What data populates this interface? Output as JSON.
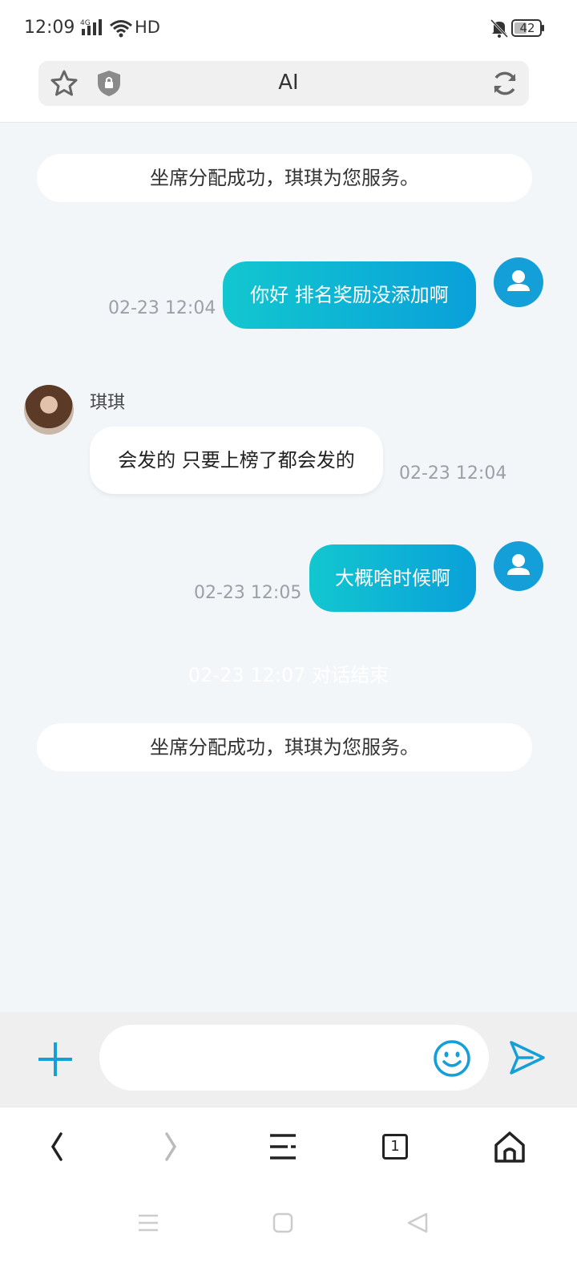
{
  "status_bar": {
    "time": "12:09",
    "network": "HD",
    "signal_label": "4G",
    "battery": "42"
  },
  "url_bar": {
    "title": "AI"
  },
  "messages": {
    "system_1": "坐席分配成功，琪琪为您服务。",
    "out_1_text": "你好 排名奖励没添加啊",
    "out_1_time": "02-23 12:04",
    "agent_name": "琪琪",
    "in_1_text": "会发的 只要上榜了都会发的",
    "in_1_time": "02-23 12:04",
    "out_2_text": "大概啥时候啊",
    "out_2_time": "02-23 12:05",
    "ended_note": "02-23 12:07 对话结束",
    "system_2": "坐席分配成功，琪琪为您服务。"
  },
  "input": {
    "value": "",
    "placeholder": ""
  },
  "browser_nav": {
    "tab_count": "1"
  },
  "colors": {
    "accent": "#149fd8",
    "bubble_start": "#12c7cf",
    "bubble_end": "#0aa0da",
    "chat_background": "#f3f6f9"
  },
  "icons": {
    "url_bar": [
      "star-icon",
      "shield-lock-icon",
      "refresh-icon"
    ],
    "input_bar": [
      "plus-icon",
      "emoji-icon",
      "send-icon"
    ],
    "browser_nav": [
      "back-icon",
      "forward-icon",
      "menu-icon",
      "tabs-icon",
      "home-icon"
    ],
    "system_nav": [
      "recents-icon",
      "home-square-icon",
      "back-triangle-icon"
    ]
  }
}
